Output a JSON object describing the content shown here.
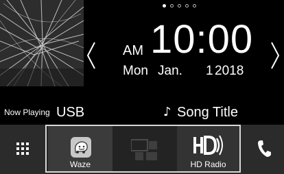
{
  "page_indicator": {
    "count": 5,
    "active_index": 0
  },
  "clock": {
    "ampm": "AM",
    "time": "10:00",
    "weekday": "Mon",
    "month": "Jan.",
    "day": "1",
    "year": "2018"
  },
  "now_playing": {
    "label": "Now Playing",
    "source": "USB",
    "song_title": "Song Title"
  },
  "shortcuts": [
    {
      "label": "Waze",
      "icon": "waze-icon"
    },
    {
      "label": "",
      "icon": "apps-icon"
    },
    {
      "label": "HD Radio",
      "icon": "hd-radio-icon"
    }
  ],
  "icons": {
    "menu": "grid-icon",
    "phone": "phone-icon",
    "prev": "chevron-left-icon",
    "next": "chevron-right-icon",
    "music": "music-note-icon"
  },
  "colors": {
    "background": "#000000",
    "bar": "#2a2a2a",
    "highlight_border": "#d8d8d8",
    "waze_tile": "#c8c8c8"
  }
}
